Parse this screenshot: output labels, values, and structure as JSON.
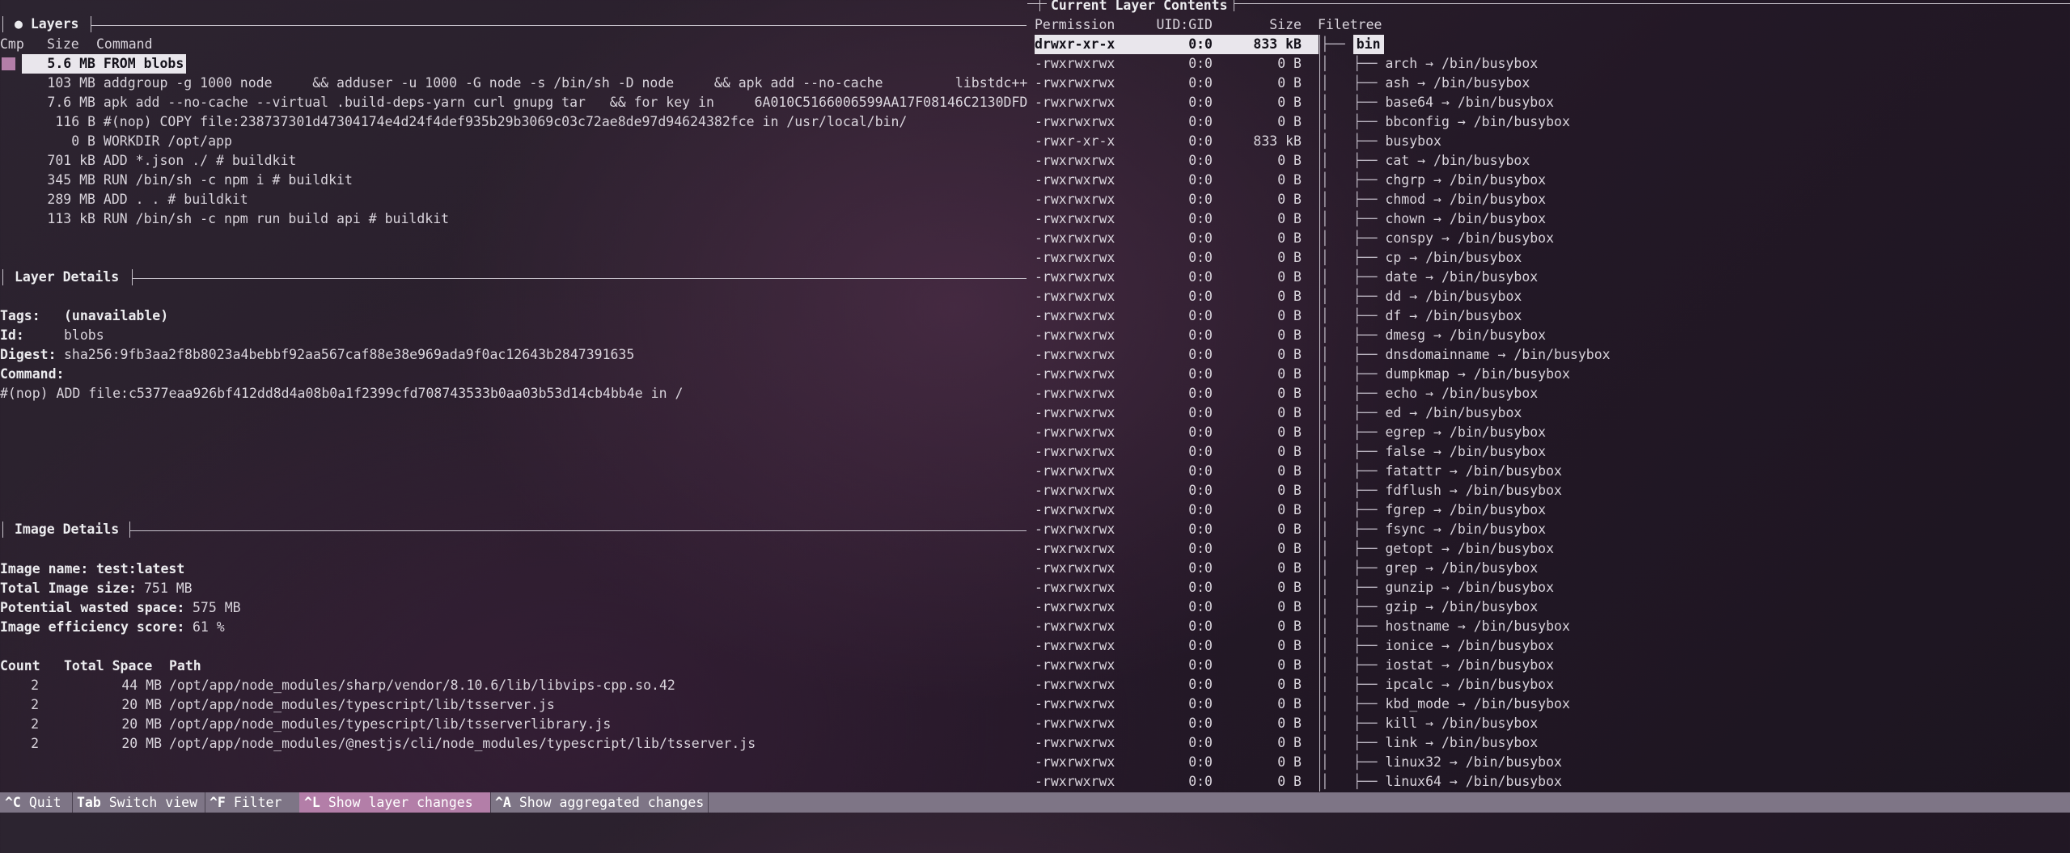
{
  "layers_panel": {
    "title": "● Layers",
    "header": {
      "cmp": "Cmp",
      "size": "Size",
      "command": "Command"
    },
    "rows": [
      {
        "size": "5.6 MB",
        "command": "FROM blobs"
      },
      {
        "size": "103 MB",
        "command": "addgroup -g 1000 node     && adduser -u 1000 -G node -s /bin/sh -D node     && apk add --no-cache         libstdc++"
      },
      {
        "size": "7.6 MB",
        "command": "apk add --no-cache --virtual .build-deps-yarn curl gnupg tar   && for key in     6A010C5166006599AA17F08146C2130DFD"
      },
      {
        "size": "116 B",
        "command": "#(nop) COPY file:238737301d47304174e4d24f4def935b29b3069c03c72ae8de97d94624382fce in /usr/local/bin/"
      },
      {
        "size": "0 B",
        "command": "WORKDIR /opt/app"
      },
      {
        "size": "701 kB",
        "command": "ADD *.json ./ # buildkit"
      },
      {
        "size": "345 MB",
        "command": "RUN /bin/sh -c npm i # buildkit"
      },
      {
        "size": "289 MB",
        "command": "ADD . . # buildkit"
      },
      {
        "size": "113 kB",
        "command": "RUN /bin/sh -c npm run build api # buildkit"
      }
    ]
  },
  "layer_details": {
    "title": "Layer Details",
    "tags_label": "Tags:",
    "tags_value": "(unavailable)",
    "id_label": "Id:",
    "id_value": "blobs",
    "digest_label": "Digest:",
    "digest_value": "sha256:9fb3aa2f8b8023a4bebbf92aa567caf88e38e969ada9f0ac12643b2847391635",
    "command_label": "Command:",
    "command_value": "#(nop) ADD file:c5377eaa926bf412dd8d4a08b0a1f2399cfd708743533b0aa03b53d14cb4bb4e in /"
  },
  "image_details": {
    "title": "Image Details",
    "name_label": "Image name:",
    "name_value": "test:latest",
    "size_label": "Total Image size:",
    "size_value": "751 MB",
    "wasted_label": "Potential wasted space:",
    "wasted_value": "575 MB",
    "efficiency_label": "Image efficiency score:",
    "efficiency_value": "61 %",
    "header": {
      "count": "Count",
      "space": "Total Space",
      "path": "Path"
    },
    "rows": [
      {
        "count": "2",
        "space": "44 MB",
        "path": "/opt/app/node_modules/sharp/vendor/8.10.6/lib/libvips-cpp.so.42"
      },
      {
        "count": "2",
        "space": "20 MB",
        "path": "/opt/app/node_modules/typescript/lib/tsserver.js"
      },
      {
        "count": "2",
        "space": "20 MB",
        "path": "/opt/app/node_modules/typescript/lib/tsserverlibrary.js"
      },
      {
        "count": "2",
        "space": "20 MB",
        "path": "/opt/app/node_modules/@nestjs/cli/node_modules/typescript/lib/tsserver.js"
      }
    ]
  },
  "contents_panel": {
    "title": "Current Layer Contents",
    "header": {
      "permission": "Permission",
      "uid_gid": "UID:GID",
      "size": "Size",
      "filetree": "Filetree"
    },
    "rows": [
      {
        "perm": "drwxr-xr-x",
        "uid": "0:0",
        "size": "833 kB",
        "tree": "├── ",
        "name": "bin"
      },
      {
        "perm": "-rwxrwxrwx",
        "uid": "0:0",
        "size": "0 B",
        "tree": "│   ├── ",
        "name": "arch → /bin/busybox"
      },
      {
        "perm": "-rwxrwxrwx",
        "uid": "0:0",
        "size": "0 B",
        "tree": "│   ├── ",
        "name": "ash → /bin/busybox"
      },
      {
        "perm": "-rwxrwxrwx",
        "uid": "0:0",
        "size": "0 B",
        "tree": "│   ├── ",
        "name": "base64 → /bin/busybox"
      },
      {
        "perm": "-rwxrwxrwx",
        "uid": "0:0",
        "size": "0 B",
        "tree": "│   ├── ",
        "name": "bbconfig → /bin/busybox"
      },
      {
        "perm": "-rwxr-xr-x",
        "uid": "0:0",
        "size": "833 kB",
        "tree": "│   ├── ",
        "name": "busybox"
      },
      {
        "perm": "-rwxrwxrwx",
        "uid": "0:0",
        "size": "0 B",
        "tree": "│   ├── ",
        "name": "cat → /bin/busybox"
      },
      {
        "perm": "-rwxrwxrwx",
        "uid": "0:0",
        "size": "0 B",
        "tree": "│   ├── ",
        "name": "chgrp → /bin/busybox"
      },
      {
        "perm": "-rwxrwxrwx",
        "uid": "0:0",
        "size": "0 B",
        "tree": "│   ├── ",
        "name": "chmod → /bin/busybox"
      },
      {
        "perm": "-rwxrwxrwx",
        "uid": "0:0",
        "size": "0 B",
        "tree": "│   ├── ",
        "name": "chown → /bin/busybox"
      },
      {
        "perm": "-rwxrwxrwx",
        "uid": "0:0",
        "size": "0 B",
        "tree": "│   ├── ",
        "name": "conspy → /bin/busybox"
      },
      {
        "perm": "-rwxrwxrwx",
        "uid": "0:0",
        "size": "0 B",
        "tree": "│   ├── ",
        "name": "cp → /bin/busybox"
      },
      {
        "perm": "-rwxrwxrwx",
        "uid": "0:0",
        "size": "0 B",
        "tree": "│   ├── ",
        "name": "date → /bin/busybox"
      },
      {
        "perm": "-rwxrwxrwx",
        "uid": "0:0",
        "size": "0 B",
        "tree": "│   ├── ",
        "name": "dd → /bin/busybox"
      },
      {
        "perm": "-rwxrwxrwx",
        "uid": "0:0",
        "size": "0 B",
        "tree": "│   ├── ",
        "name": "df → /bin/busybox"
      },
      {
        "perm": "-rwxrwxrwx",
        "uid": "0:0",
        "size": "0 B",
        "tree": "│   ├── ",
        "name": "dmesg → /bin/busybox"
      },
      {
        "perm": "-rwxrwxrwx",
        "uid": "0:0",
        "size": "0 B",
        "tree": "│   ├── ",
        "name": "dnsdomainname → /bin/busybox"
      },
      {
        "perm": "-rwxrwxrwx",
        "uid": "0:0",
        "size": "0 B",
        "tree": "│   ├── ",
        "name": "dumpkmap → /bin/busybox"
      },
      {
        "perm": "-rwxrwxrwx",
        "uid": "0:0",
        "size": "0 B",
        "tree": "│   ├── ",
        "name": "echo → /bin/busybox"
      },
      {
        "perm": "-rwxrwxrwx",
        "uid": "0:0",
        "size": "0 B",
        "tree": "│   ├── ",
        "name": "ed → /bin/busybox"
      },
      {
        "perm": "-rwxrwxrwx",
        "uid": "0:0",
        "size": "0 B",
        "tree": "│   ├── ",
        "name": "egrep → /bin/busybox"
      },
      {
        "perm": "-rwxrwxrwx",
        "uid": "0:0",
        "size": "0 B",
        "tree": "│   ├── ",
        "name": "false → /bin/busybox"
      },
      {
        "perm": "-rwxrwxrwx",
        "uid": "0:0",
        "size": "0 B",
        "tree": "│   ├── ",
        "name": "fatattr → /bin/busybox"
      },
      {
        "perm": "-rwxrwxrwx",
        "uid": "0:0",
        "size": "0 B",
        "tree": "│   ├── ",
        "name": "fdflush → /bin/busybox"
      },
      {
        "perm": "-rwxrwxrwx",
        "uid": "0:0",
        "size": "0 B",
        "tree": "│   ├── ",
        "name": "fgrep → /bin/busybox"
      },
      {
        "perm": "-rwxrwxrwx",
        "uid": "0:0",
        "size": "0 B",
        "tree": "│   ├── ",
        "name": "fsync → /bin/busybox"
      },
      {
        "perm": "-rwxrwxrwx",
        "uid": "0:0",
        "size": "0 B",
        "tree": "│   ├── ",
        "name": "getopt → /bin/busybox"
      },
      {
        "perm": "-rwxrwxrwx",
        "uid": "0:0",
        "size": "0 B",
        "tree": "│   ├── ",
        "name": "grep → /bin/busybox"
      },
      {
        "perm": "-rwxrwxrwx",
        "uid": "0:0",
        "size": "0 B",
        "tree": "│   ├── ",
        "name": "gunzip → /bin/busybox"
      },
      {
        "perm": "-rwxrwxrwx",
        "uid": "0:0",
        "size": "0 B",
        "tree": "│   ├── ",
        "name": "gzip → /bin/busybox"
      },
      {
        "perm": "-rwxrwxrwx",
        "uid": "0:0",
        "size": "0 B",
        "tree": "│   ├── ",
        "name": "hostname → /bin/busybox"
      },
      {
        "perm": "-rwxrwxrwx",
        "uid": "0:0",
        "size": "0 B",
        "tree": "│   ├── ",
        "name": "ionice → /bin/busybox"
      },
      {
        "perm": "-rwxrwxrwx",
        "uid": "0:0",
        "size": "0 B",
        "tree": "│   ├── ",
        "name": "iostat → /bin/busybox"
      },
      {
        "perm": "-rwxrwxrwx",
        "uid": "0:0",
        "size": "0 B",
        "tree": "│   ├── ",
        "name": "ipcalc → /bin/busybox"
      },
      {
        "perm": "-rwxrwxrwx",
        "uid": "0:0",
        "size": "0 B",
        "tree": "│   ├── ",
        "name": "kbd_mode → /bin/busybox"
      },
      {
        "perm": "-rwxrwxrwx",
        "uid": "0:0",
        "size": "0 B",
        "tree": "│   ├── ",
        "name": "kill → /bin/busybox"
      },
      {
        "perm": "-rwxrwxrwx",
        "uid": "0:0",
        "size": "0 B",
        "tree": "│   ├── ",
        "name": "link → /bin/busybox"
      },
      {
        "perm": "-rwxrwxrwx",
        "uid": "0:0",
        "size": "0 B",
        "tree": "│   ├── ",
        "name": "linux32 → /bin/busybox"
      },
      {
        "perm": "-rwxrwxrwx",
        "uid": "0:0",
        "size": "0 B",
        "tree": "│   ├── ",
        "name": "linux64 → /bin/busybox"
      }
    ]
  },
  "status_bar": {
    "items": [
      {
        "key": "^C",
        "label": "Quit"
      },
      {
        "key": "Tab",
        "label": "Switch view"
      },
      {
        "key": "^F",
        "label": "Filter"
      },
      {
        "key": "^L",
        "label": "Show layer changes",
        "active": true
      },
      {
        "key": "^A",
        "label": "Show aggregated changes"
      }
    ]
  },
  "colors": {
    "accent": "#b37ea8",
    "status_bar": "#7e7586",
    "selection": "#e9e6ec"
  }
}
